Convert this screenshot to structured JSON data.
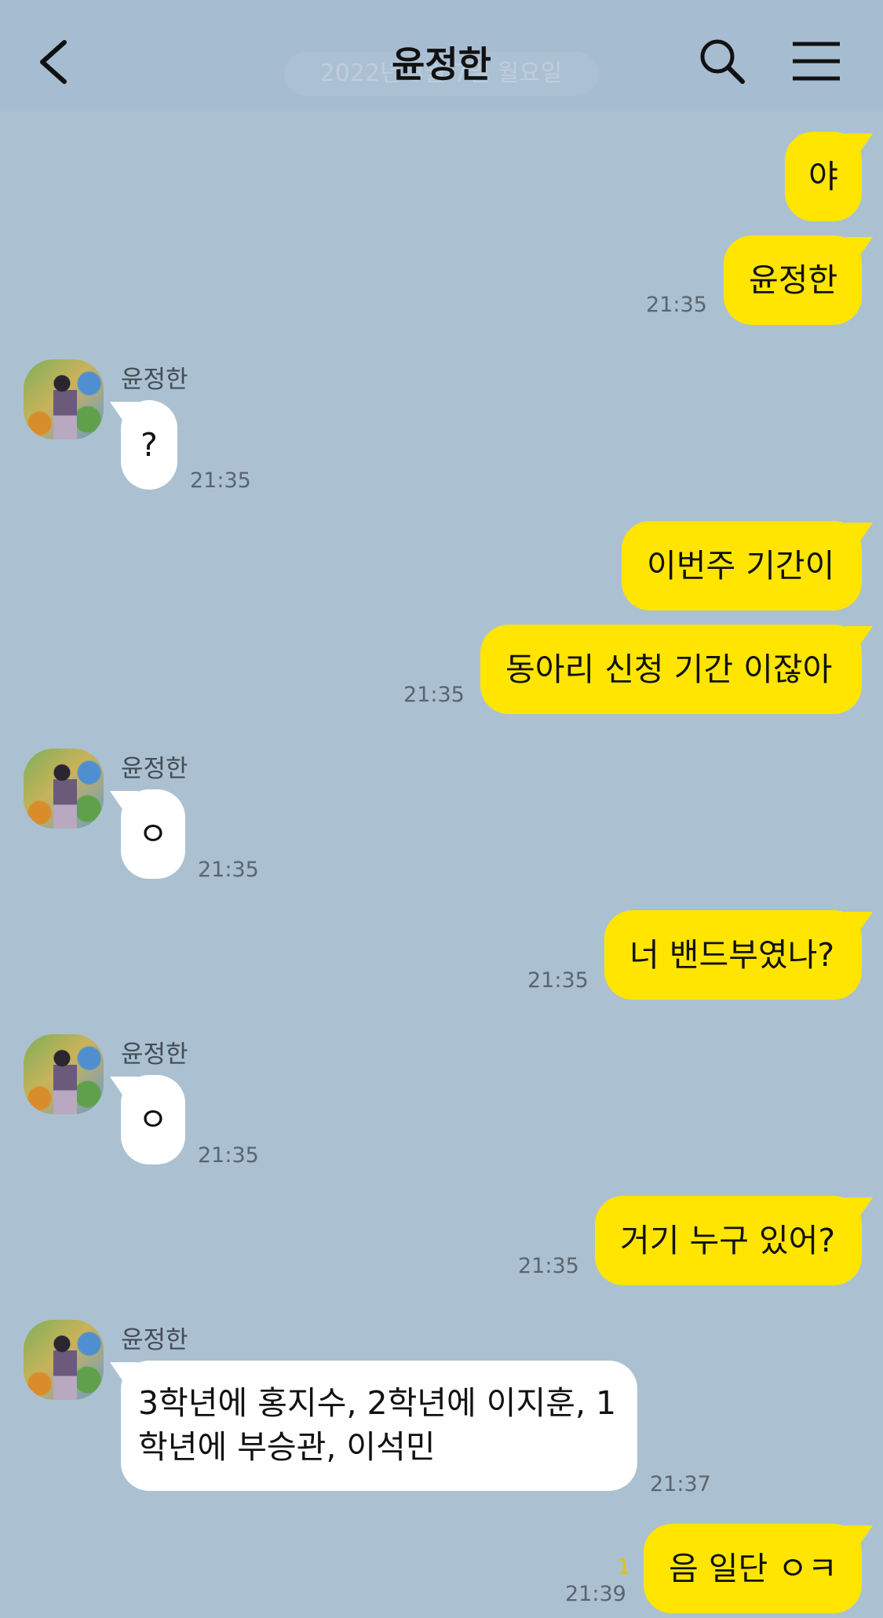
{
  "header": {
    "title": "윤정한",
    "date_overlay": "2022년 3월 7일 월요일",
    "icons": [
      "back-icon",
      "search-icon",
      "menu-icon"
    ]
  },
  "contact": {
    "name": "윤정한"
  },
  "messages": [
    {
      "from": "me",
      "text": "야"
    },
    {
      "from": "me",
      "text": "윤정한",
      "time": "21:35"
    },
    {
      "from": "them",
      "text": "?",
      "time": "21:35"
    },
    {
      "from": "me",
      "text": "이번주 기간이"
    },
    {
      "from": "me",
      "text": "동아리 신청 기간 이잖아",
      "time": "21:35"
    },
    {
      "from": "them",
      "text": "ㅇ",
      "time": "21:35"
    },
    {
      "from": "me",
      "text": "너 밴드부였나?",
      "time": "21:35"
    },
    {
      "from": "them",
      "text": "ㅇ",
      "time": "21:35"
    },
    {
      "from": "me",
      "text": "거기 누구 있어?",
      "time": "21:35"
    },
    {
      "from": "them",
      "text": "3학년에 홍지수, 2학년에 이지훈, 1학년에 부승관, 이석민",
      "time": "21:37"
    },
    {
      "from": "me",
      "text": "음 일단 ㅇㅋ",
      "time": "21:39",
      "unread": "1"
    }
  ],
  "colors": {
    "background": "#abc1d1",
    "my_bubble": "#ffe500",
    "their_bubble": "#ffffff",
    "unread_count": "#e6c200"
  }
}
